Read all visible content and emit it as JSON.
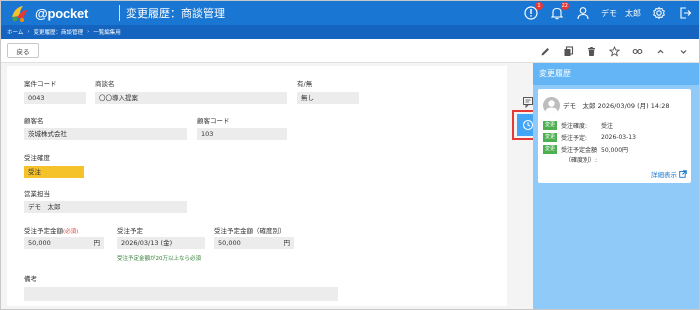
{
  "header": {
    "logo_text": "@pocket",
    "page_title": "変更履歴：商談管理",
    "notification_badge_1": "1",
    "notification_badge_2": "22",
    "user_name": "デモ　太郎"
  },
  "breadcrumb": [
    "ホーム",
    "変更履歴：商談管理",
    "一覧編集用"
  ],
  "breadcrumb_sep": "›",
  "toolbar": {
    "back_label": "戻る"
  },
  "form": {
    "case_code_label": "案件コード",
    "case_code_value": "0043",
    "deal_name_label": "商談名",
    "deal_name_value": "〇〇導入提案",
    "existence_label": "有/無",
    "existence_value": "無し",
    "customer_name_label": "顧客名",
    "customer_name_value": "茨城株式会社",
    "customer_code_label": "顧客コード",
    "customer_code_value": "103",
    "accuracy_label": "受注確度",
    "accuracy_value": "受注",
    "sales_rep_label": "営業担当",
    "sales_rep_value": "デモ　太郎",
    "order_amount_label": "受注予定金額",
    "required_mark": "(必須)",
    "order_amount_value": "50,000",
    "yen_unit": "円",
    "order_date_label": "受注予定",
    "order_date_value": "2026/03/13 (金)",
    "amount_hint": "受注予定金額が20万以上なら必須",
    "weighted_amount_label": "受注予定金額（確度別）",
    "weighted_amount_value": "50,000",
    "remarks_label": "備考",
    "remarks_value": ""
  },
  "history_panel": {
    "title": "変更履歴",
    "entry_user_date": "デモ　太郎 2026/03/09 (月) 14:28",
    "badge_label": "変更",
    "changes": [
      {
        "field": "受注確度:",
        "value": "受注"
      },
      {
        "field": "受注予定:",
        "value": "2026-03-13"
      },
      {
        "field": "受注予定金額",
        "value": "50,000円"
      }
    ],
    "change_3_sub": "（確度別）:",
    "detail_link": "詳細表示"
  },
  "colors": {
    "header_blue": "#1976d2",
    "breadcrumb_blue": "#1565c0",
    "panel_blue": "#90caf9",
    "panel_header_blue": "#64b5f6",
    "status_yellow": "#f6c22b",
    "change_badge_green": "#4caf50",
    "highlight_red": "#e53935"
  },
  "icons": [
    "info-icon",
    "bell-icon",
    "user-icon",
    "gear-icon",
    "logout-icon",
    "pencil-icon",
    "copy-icon",
    "trash-icon",
    "star-icon",
    "link-icon",
    "chevron-up-icon",
    "chevron-down-icon",
    "comment-icon",
    "clock-icon",
    "external-link-icon"
  ]
}
